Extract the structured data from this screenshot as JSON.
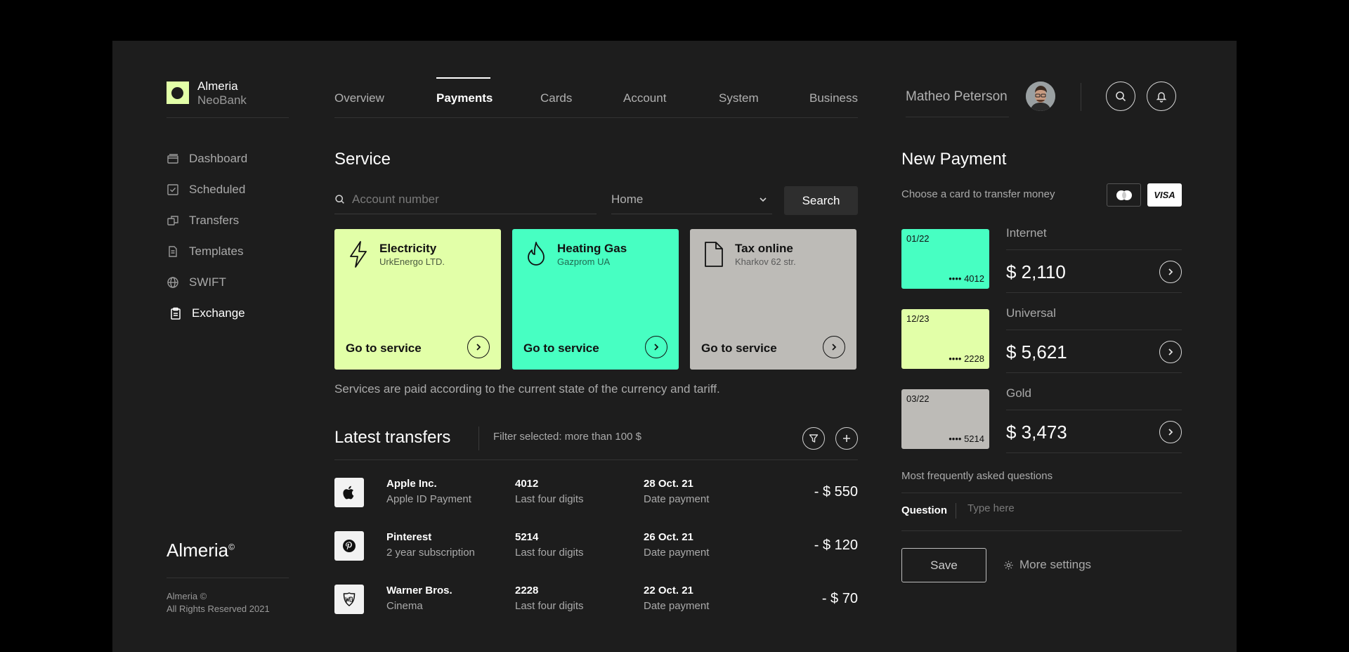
{
  "brand": {
    "name": "Almeria",
    "sub": "NeoBank",
    "footer_name": "Almeria",
    "footer_mark": "©",
    "copyright_line1": "Almeria ©",
    "copyright_line2": "All Rights Reserved 2021"
  },
  "sidebar": {
    "items": [
      {
        "label": "Dashboard",
        "icon": "dashboard-icon"
      },
      {
        "label": "Scheduled",
        "icon": "check-square-icon"
      },
      {
        "label": "Transfers",
        "icon": "transfer-icon"
      },
      {
        "label": "Templates",
        "icon": "document-icon"
      },
      {
        "label": "SWIFT",
        "icon": "globe-icon"
      },
      {
        "label": "Exchange",
        "icon": "clipboard-icon",
        "active": true
      }
    ]
  },
  "nav": {
    "tabs": [
      {
        "label": "Overview"
      },
      {
        "label": "Payments",
        "active": true
      },
      {
        "label": "Cards"
      },
      {
        "label": "Account"
      },
      {
        "label": "System"
      },
      {
        "label": "Business"
      }
    ]
  },
  "user": {
    "name": "Matheo Peterson"
  },
  "service": {
    "title": "Service",
    "search_placeholder": "Account number",
    "select_value": "Home",
    "search_button": "Search",
    "cards": [
      {
        "title": "Electricity",
        "subtitle": "UrkEnergo LTD.",
        "action": "Go to service",
        "color": "#e2ffa8",
        "icon": "lightning-icon"
      },
      {
        "title": "Heating Gas",
        "subtitle": "Gazprom UA",
        "action": "Go to service",
        "color": "#47ffc2",
        "icon": "flame-icon"
      },
      {
        "title": "Tax online",
        "subtitle": "Kharkov 62 str.",
        "action": "Go to service",
        "color": "#bdbbb7",
        "icon": "document-icon"
      }
    ],
    "note": "Services are paid according to the current state of the currency and tariff."
  },
  "transfers": {
    "title": "Latest transfers",
    "filter": "Filter selected: more than 100 $",
    "rows": [
      {
        "name": "Apple Inc.",
        "desc": "Apple ID Payment",
        "digits": "4012",
        "digits_label": "Last four digits",
        "date": "28 Oct. 21",
        "date_label": "Date payment",
        "amount": "- $ 550",
        "icon": "apple-icon"
      },
      {
        "name": "Pinterest",
        "desc": "2 year subscription",
        "digits": "5214",
        "digits_label": "Last four digits",
        "date": "26 Oct. 21",
        "date_label": "Date payment",
        "amount": "- $ 120",
        "icon": "pinterest-icon"
      },
      {
        "name": "Warner Bros.",
        "desc": "Cinema",
        "digits": "2228",
        "digits_label": "Last four digits",
        "date": "22 Oct. 21",
        "date_label": "Date payment",
        "amount": "- $ 70",
        "icon": "warner-bros-icon"
      }
    ]
  },
  "new_payment": {
    "title": "New Payment",
    "choose": "Choose a card to transfer money",
    "visa": "VISA",
    "cards": [
      {
        "exp": "01/22",
        "num": "•••• 4012",
        "label": "Internet",
        "amount": "$ 2,110",
        "color": "#47ffc2"
      },
      {
        "exp": "12/23",
        "num": "•••• 2228",
        "label": "Universal",
        "amount": "$ 5,621",
        "color": "#e2ffa8"
      },
      {
        "exp": "03/22",
        "num": "•••• 5214",
        "label": "Gold",
        "amount": "$ 3,473",
        "color": "#bdbbb7"
      }
    ],
    "faq": "Most frequently asked questions",
    "question_label": "Question",
    "question_placeholder": "Type here",
    "save": "Save",
    "more_settings": "More settings"
  }
}
